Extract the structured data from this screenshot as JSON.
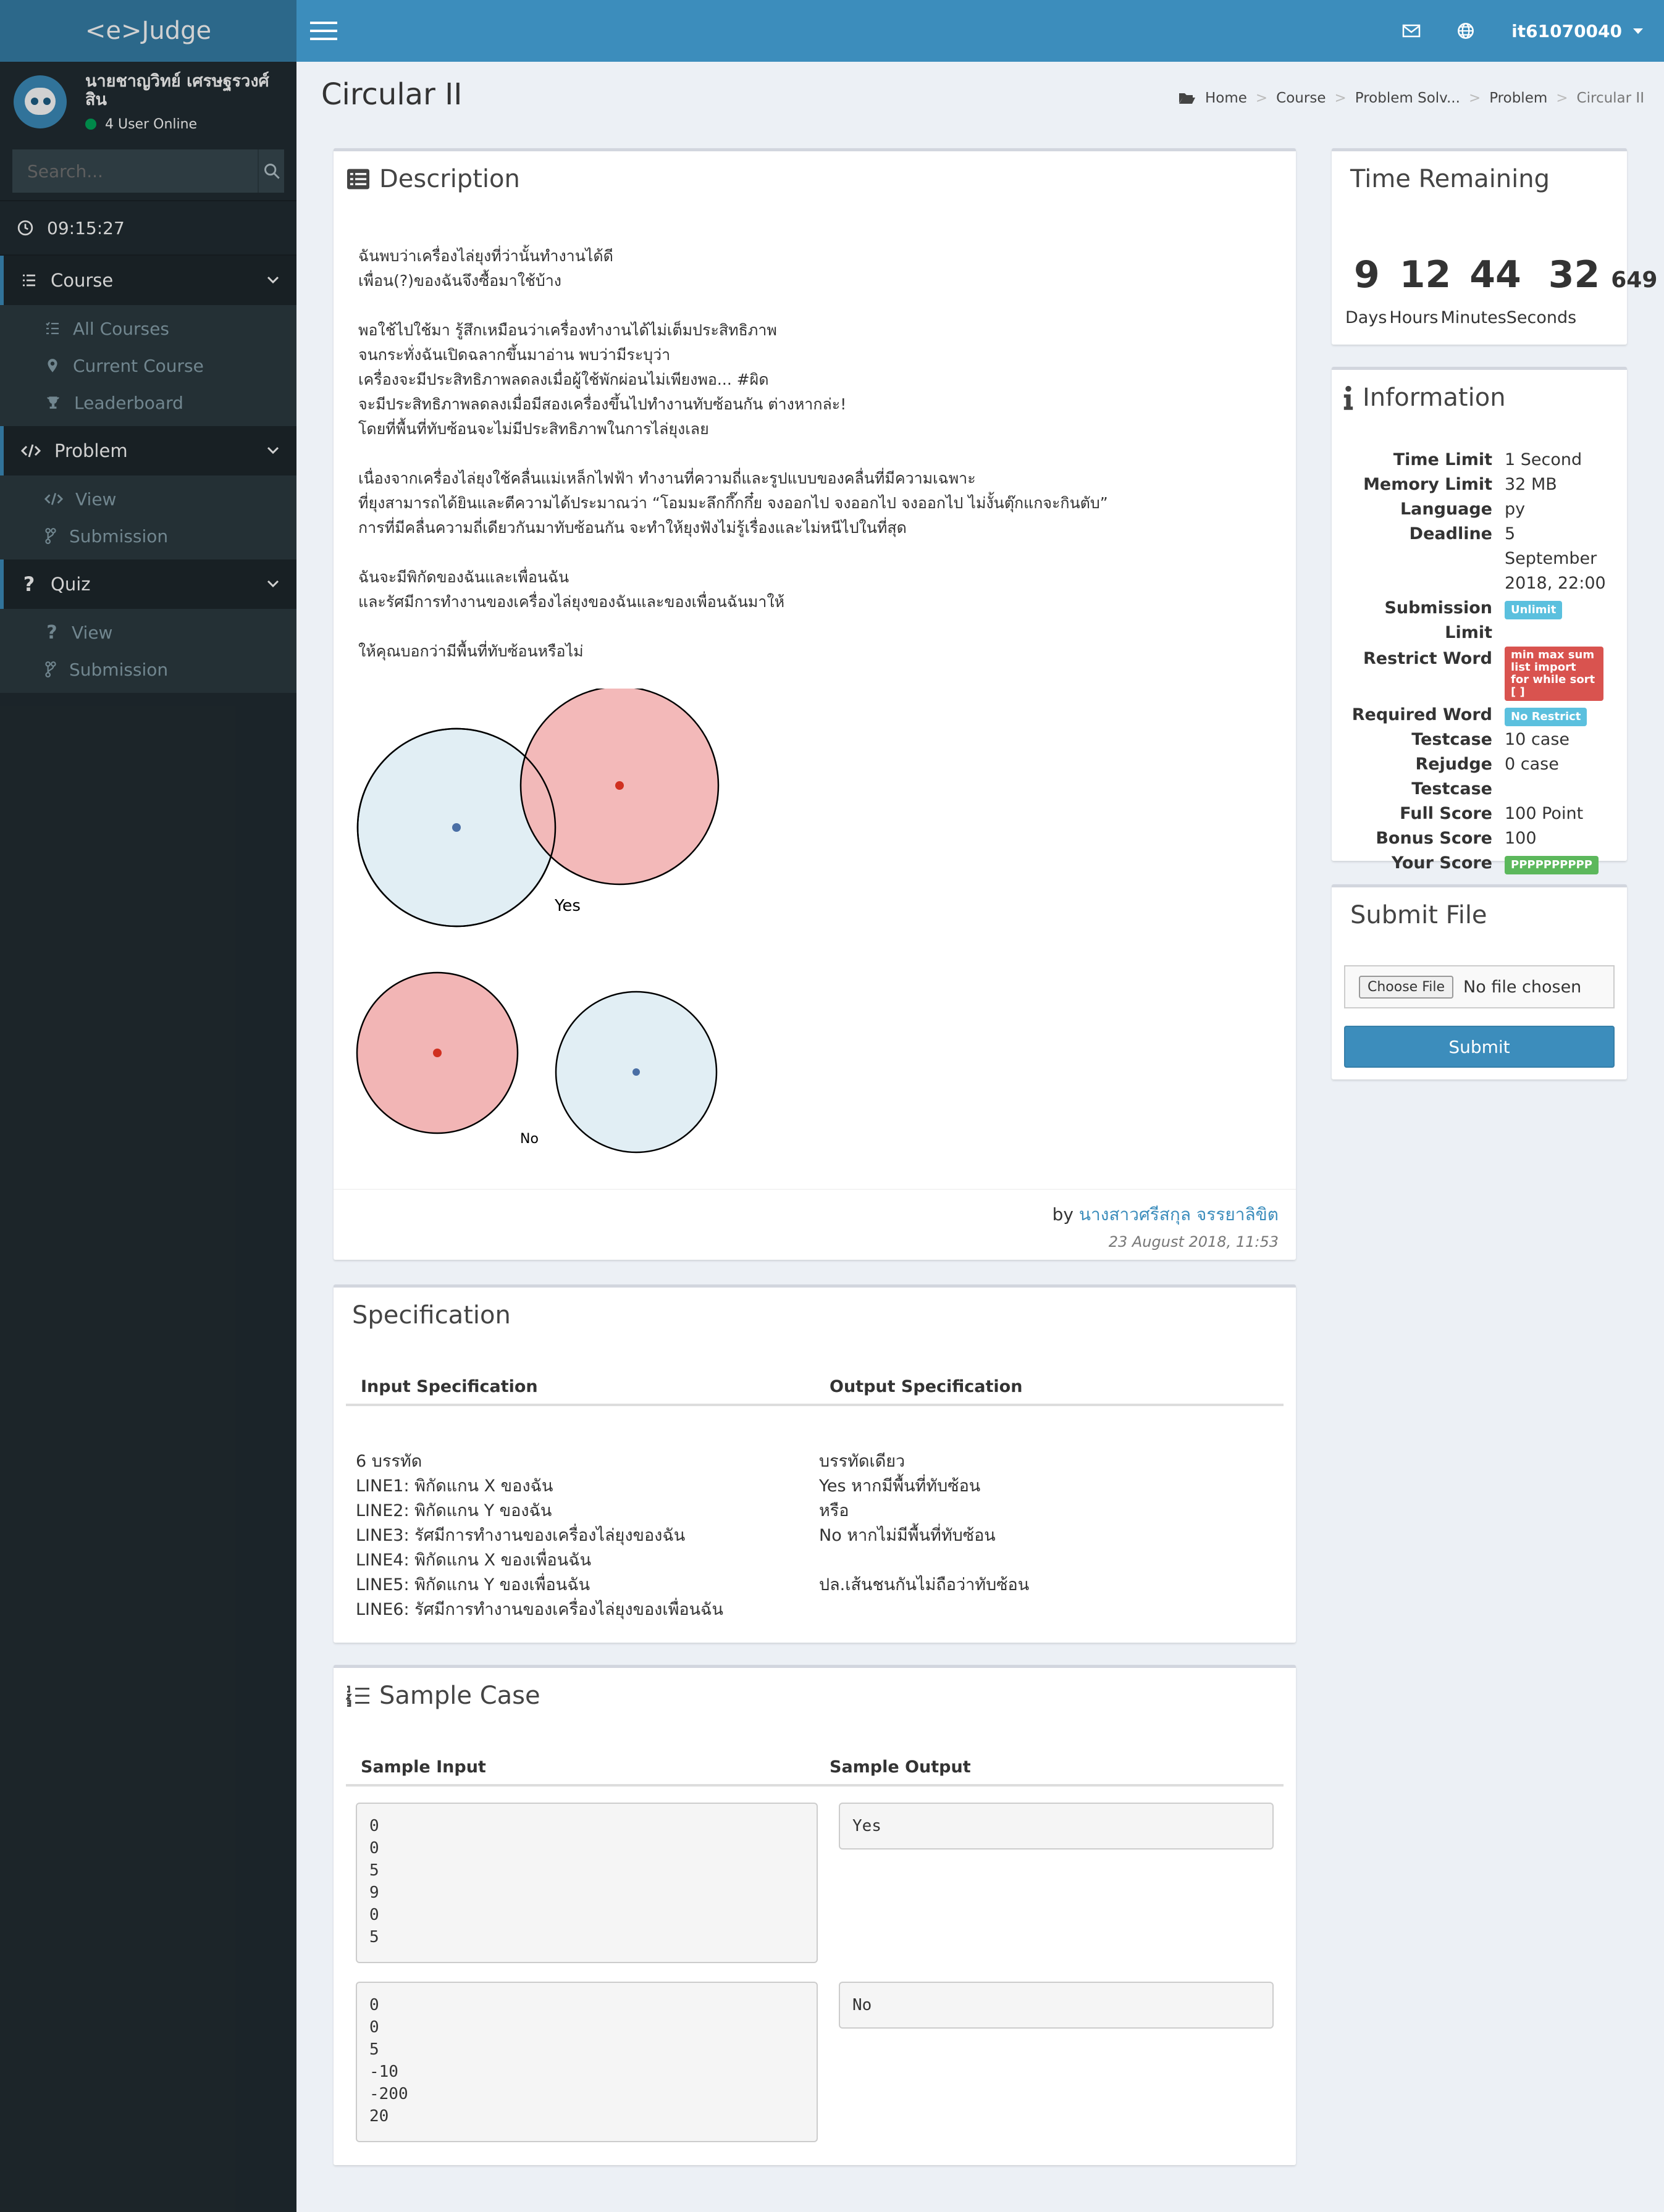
{
  "brand": "<e>Judge",
  "user": {
    "name": "นายชาญวิทย์ เศรษฐรวงศ์สิน",
    "status": "4 User Online"
  },
  "search": {
    "placeholder": "Search..."
  },
  "clock": "09:15:27",
  "menu": {
    "course": {
      "label": "Course",
      "items": [
        "All Courses",
        "Current Course",
        "Leaderboard"
      ]
    },
    "problem": {
      "label": "Problem",
      "items": [
        "View",
        "Submission"
      ]
    },
    "quiz": {
      "label": "Quiz",
      "items": [
        "View",
        "Submission"
      ]
    }
  },
  "topbar": {
    "username": "it61070040"
  },
  "page": {
    "title": "Circular II"
  },
  "breadcrumb": [
    "Home",
    "Course",
    "Problem Solv...",
    "Problem",
    "Circular II"
  ],
  "description": {
    "title": "Description",
    "paragraphs": [
      "ฉันพบว่าเครื่องไล่ยุงที่ว่านั้นทำงานได้ดี\nเพื่อน(?)ของฉันจึงซื้อมาใช้บ้าง",
      "พอใช้ไปใช้มา รู้สึกเหมือนว่าเครื่องทำงานได้ไม่เต็มประสิทธิภาพ\nจนกระทั่งฉันเปิดฉลากขึ้นมาอ่าน พบว่ามีระบุว่า\nเครื่องจะมีประสิทธิภาพลดลงเมื่อผู้ใช้พักผ่อนไม่เพียงพอ... #ผิด\nจะมีประสิทธิภาพลดลงเมื่อมีสองเครื่องขึ้นไปทำงานทับซ้อนกัน ต่างหากล่ะ!\nโดยที่พื้นที่ทับซ้อนจะไม่มีประสิทธิภาพในการไล่ยุงเลย",
      "เนื่องจากเครื่องไล่ยุงใช้คลื่นแม่เหล็กไฟฟ้า ทำงานที่ความถี่และรูปแบบของคลื่นที่มีความเฉพาะ\nที่ยุงสามารถได้ยินและตีความได้ประมาณว่า “โอมมะลึกกึ๊กกึ๋ย จงออกไป จงออกไป จงออกไป ไม่งั้นตุ๊กแกจะกินตับ”\nการที่มีคลื่นความถี่เดียวกันมาทับซ้อนกัน จะทำให้ยุงฟังไม่รู้เรื่องและไม่หนีไปในที่สุด",
      "ฉันจะมีพิกัดของฉันและเพื่อนฉัน\nและรัศมีการทำงานของเครื่องไล่ยุงของฉันและของเพื่อนฉันมาให้",
      "ให้คุณบอกว่ามีพื้นที่ทับซ้อนหรือไม่"
    ],
    "figure_labels": {
      "yes": "Yes",
      "no": "No"
    },
    "author_prefix": "by",
    "author": "นางสาวศรีสกุล จรรยาลิขิต",
    "date": "23 August 2018, 11:53"
  },
  "specification": {
    "title": "Specification",
    "input_header": "Input Specification",
    "output_header": "Output Specification",
    "input_lines": "6 บรรทัด\nLINE1: พิกัดแกน X ของฉัน\nLINE2: พิกัดแกน Y ของฉัน\nLINE3: รัศมีการทำงานของเครื่องไล่ยุงของฉัน\nLINE4: พิกัดแกน X ของเพื่อนฉัน\nLINE5: พิกัดแกน Y ของเพื่อนฉัน\nLINE6: รัศมีการทำงานของเครื่องไล่ยุงของเพื่อนฉัน",
    "output_lines": "บรรทัดเดียว\nYes หากมีพื้นที่ทับซ้อน\nหรือ\nNo หากไม่มีพื้นที่ทับซ้อน\n\nปล.เส้นชนกันไม่ถือว่าทับซ้อน"
  },
  "sample": {
    "title": "Sample Case",
    "input_header": "Sample Input",
    "output_header": "Sample Output",
    "cases": [
      {
        "input": "0\n0\n5\n9\n0\n5",
        "output": "Yes"
      },
      {
        "input": "0\n0\n5\n-10\n-200\n20",
        "output": "No"
      }
    ]
  },
  "timer": {
    "title": "Time Remaining",
    "days": "9",
    "hours": "12",
    "minutes": "44",
    "seconds": "32",
    "ms": "649",
    "labels": [
      "Days",
      "Hours",
      "Minutes",
      "Seconds"
    ]
  },
  "information": {
    "title": "Information",
    "time_limit": {
      "k": "Time Limit",
      "v": "1 Second"
    },
    "memory_limit": {
      "k": "Memory Limit",
      "v": "32 MB"
    },
    "language": {
      "k": "Language",
      "v": "py"
    },
    "deadline": {
      "k": "Deadline",
      "v": "5 September 2018, 22:00"
    },
    "submission_limit": {
      "k": "Submission Limit",
      "v": "Unlimit"
    },
    "restrict_word": {
      "k": "Restrict Word",
      "v": "min max sum list import for while sort [ ]"
    },
    "required_word": {
      "k": "Required Word",
      "v": "No Restrict"
    },
    "testcase": {
      "k": "Testcase",
      "v": "10 case"
    },
    "rejudge_testcase": {
      "k": "Rejudge Testcase",
      "v": "0 case"
    },
    "full_score": {
      "k": "Full Score",
      "v": "100 Point"
    },
    "bonus_score": {
      "k": "Bonus Score",
      "v": "100"
    },
    "your_score": {
      "k": "Your Score",
      "v": "PPPPPPPPPP"
    }
  },
  "submit": {
    "title": "Submit File",
    "choose_label": "Choose File",
    "no_file": "No file chosen",
    "button": "Submit"
  },
  "colors": {
    "primary": "#3c8dbc",
    "sidebar": "#222d32",
    "circle_red": "#f2b5b5",
    "circle_blue": "#e1eef4"
  }
}
